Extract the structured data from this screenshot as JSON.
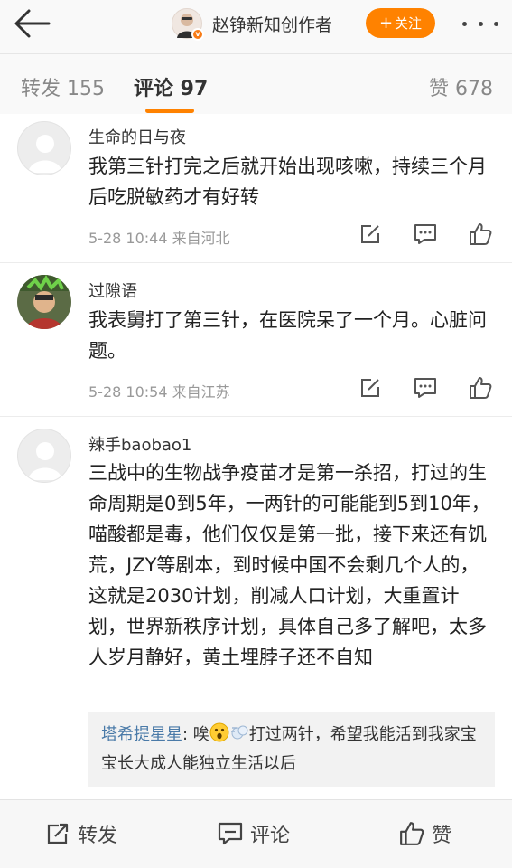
{
  "header": {
    "author_name": "赵铮新知创作者",
    "follow_label": "关注",
    "follow_plus": "+"
  },
  "tabs": {
    "repost": "转发 155",
    "comment": "评论 97",
    "like": "赞 678"
  },
  "comments": [
    {
      "user": "生命的日与夜",
      "text": "我第三针打完之后就开始出现咳嗽，持续三个月后吃脱敏药才有好转",
      "meta": "5-28 10:44 来自河北"
    },
    {
      "user": "过隙语",
      "text": "我表舅打了第三针，在医院呆了一个月。心脏问题。",
      "meta": "5-28 10:54 来自江苏"
    },
    {
      "user": "辣手baobao1",
      "text": "三战中的生物战争疫苗才是第一杀招，打过的生命周期是0到5年，一两针的可能能到5到10年，喵酸都是毒，他们仅仅是第一批，接下来还有饥荒，JZY等剧本，到时候中国不会剩几个人的，这就是2030计划，削减人口计划，大重置计划，世界新秩序计划，具体自己多了解吧，太多人岁月静好，黄土埋脖子还不自知",
      "reply": {
        "author": "塔希提星星",
        "prefix": ": 唉",
        "text": "打过两针，希望我能活到我家宝宝长大成人能独立生活以后"
      }
    }
  ],
  "bottom_bar": {
    "repost": "转发",
    "comment": "评论",
    "like": "赞"
  },
  "colors": {
    "accent": "#ff8200",
    "reply_author": "#4a7aa8"
  },
  "icons": [
    "back-arrow-icon",
    "verified-badge-icon",
    "more-icon",
    "edit-icon",
    "reply-icon",
    "thumbs-up-icon",
    "share-icon",
    "comment-icon"
  ]
}
